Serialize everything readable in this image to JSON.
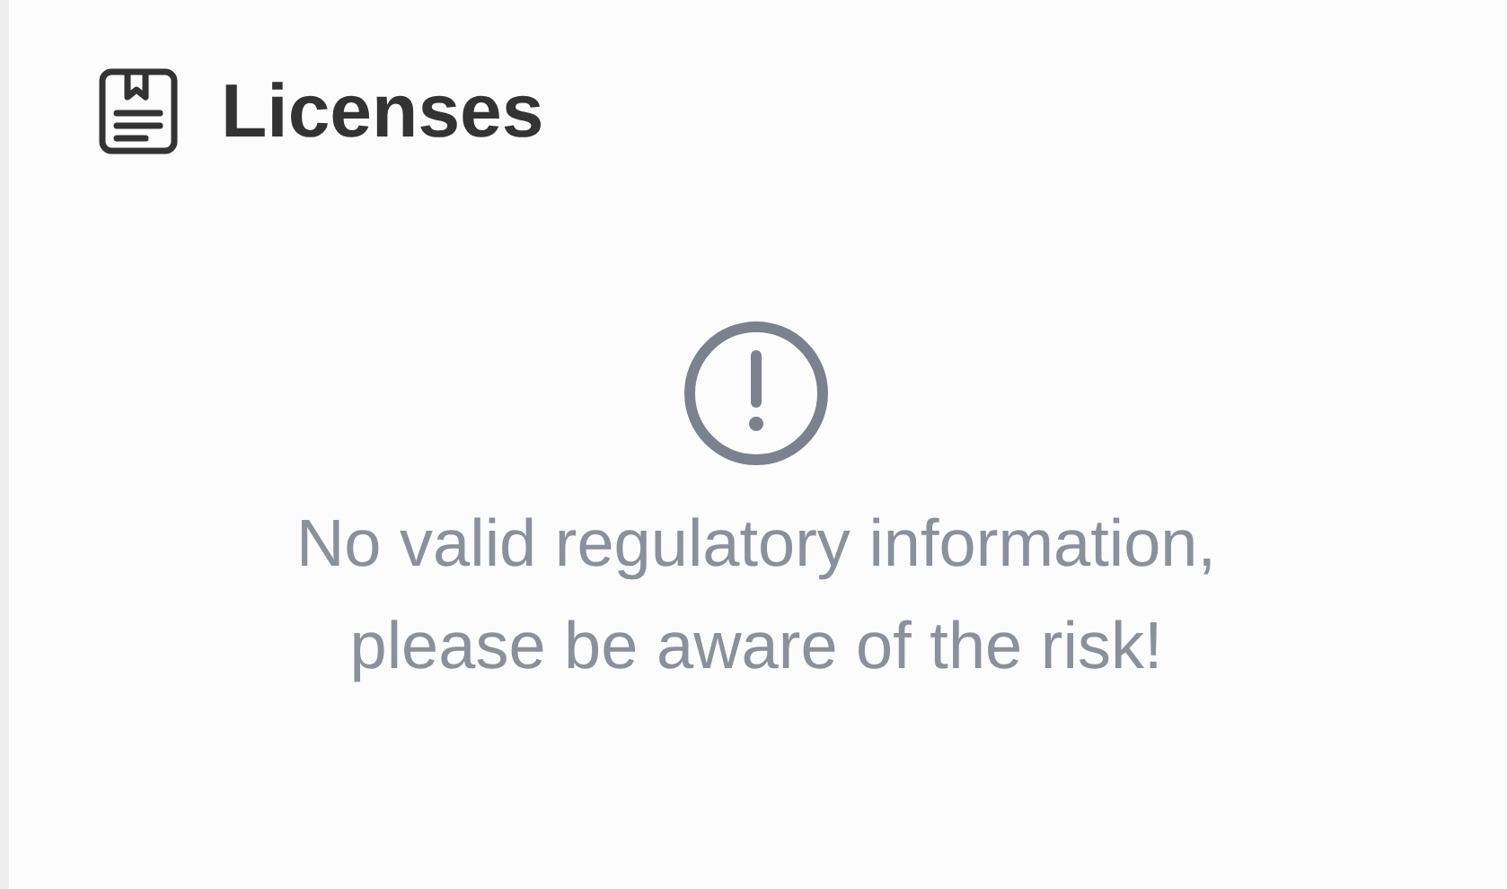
{
  "section": {
    "title": "Licenses"
  },
  "notice": {
    "lines": [
      "No valid regulatory information,",
      "please be aware of the risk!"
    ]
  }
}
